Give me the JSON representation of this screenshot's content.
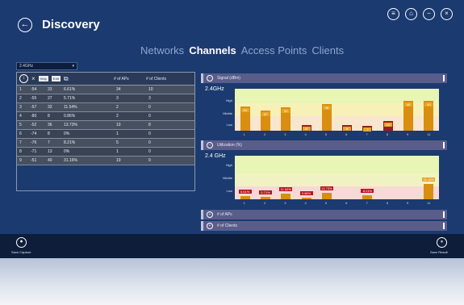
{
  "header": {
    "title": "Discovery",
    "back_icon": "arrow-left-icon"
  },
  "window_controls": [
    {
      "name": "menu-icon",
      "glyph": "≡"
    },
    {
      "name": "home-icon",
      "glyph": "⌂"
    },
    {
      "name": "minimize-icon",
      "glyph": "−"
    },
    {
      "name": "close-icon",
      "glyph": "×"
    }
  ],
  "tabs": [
    {
      "label": "Networks",
      "active": false
    },
    {
      "label": "Channels",
      "active": true
    },
    {
      "label": "Access Points",
      "active": false
    },
    {
      "label": "Clients",
      "active": false
    }
  ],
  "band_select": {
    "value": "2.4GHz"
  },
  "table": {
    "toolbar": {
      "btn1": "Help",
      "btn2": "Edit"
    },
    "headers": [
      "",
      "",
      "",
      "",
      "# of APs",
      "# of Clients"
    ],
    "rows": [
      [
        "1",
        "-54",
        "33",
        "6.61%",
        "34",
        "10"
      ],
      [
        "2",
        "-55",
        "27",
        "5.71%",
        "3",
        "3"
      ],
      [
        "3",
        "-57",
        "32",
        "11.54%",
        "2",
        "0"
      ],
      [
        "4",
        "-80",
        "8",
        "0.86%",
        "2",
        "0"
      ],
      [
        "5",
        "-52",
        "36",
        "13.73%",
        "19",
        "8"
      ],
      [
        "6",
        "-74",
        "8",
        "0%",
        "1",
        "0"
      ],
      [
        "7",
        "-76",
        "7",
        "8.21%",
        "5",
        "0"
      ],
      [
        "8",
        "-71",
        "13",
        "0%",
        "1",
        "0"
      ],
      [
        "9",
        "-51",
        "40",
        "31.16%",
        "19",
        "9"
      ]
    ]
  },
  "signal_panel": {
    "header": "Signal (dBm)",
    "band_label": "2.4GHz",
    "levels": [
      "High",
      "Middle",
      "Low"
    ],
    "channels": [
      "1",
      "2",
      "3",
      "4",
      "5",
      "6",
      "7",
      "8",
      "9",
      "11"
    ],
    "values": [
      33,
      27,
      32,
      8,
      36,
      8,
      7,
      13,
      40,
      40
    ]
  },
  "utilization_panel": {
    "header": "Utilization (%)",
    "band_label": "2.4 GHz",
    "levels": [
      "High",
      "Middle",
      "Low"
    ],
    "channels": [
      "1",
      "2",
      "3",
      "4",
      "5",
      "6",
      "7",
      "8",
      "9",
      "11"
    ],
    "values": [
      6.61,
      5.71,
      11.54,
      0.86,
      13.73,
      0,
      8.21,
      0,
      0,
      31.16
    ],
    "labels": [
      "6.61%",
      "5.71%",
      "11.54%",
      "0.86%",
      "13.73%",
      "",
      "8.21%",
      "",
      "",
      "31.16%"
    ]
  },
  "collapsed_panels": [
    "# of APs",
    "# of Clients"
  ],
  "bottom_bar": {
    "left_label": "Save Capture",
    "right_label": "Save Result"
  },
  "colors": {
    "background": "#1b3a70",
    "bar": "#d98e10",
    "low_bar": "#9b1c24",
    "chart_fill": "#e8f5b4"
  }
}
